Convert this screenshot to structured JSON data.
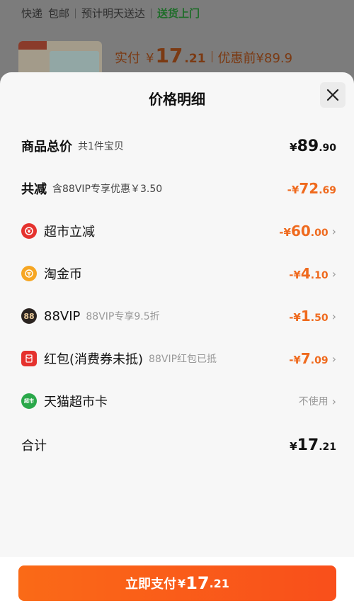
{
  "background": {
    "shipping": [
      "快递",
      "包邮",
      "预计明天送达",
      "送货上门"
    ],
    "price_prefix": "实付",
    "price_symbol": "¥",
    "price_int": "17",
    "price_dec": ".21",
    "before_discount": "优惠前¥89.9"
  },
  "sheet": {
    "title": "价格明细",
    "close_icon": "close-icon"
  },
  "rows": {
    "total": {
      "label": "商品总价",
      "note": "共1件宝贝",
      "sym": "¥",
      "int": "89",
      "dec": ".90"
    },
    "reduce": {
      "label": "共减",
      "note": "含88VIP专享优惠￥3.50",
      "sym": "-¥",
      "int": "72",
      "dec": ".69"
    },
    "supermarket": {
      "label": "超市立减",
      "sym": "-¥",
      "int": "60",
      "dec": ".00",
      "icon": "discount-tag-icon"
    },
    "taojinbi": {
      "label": "淘金币",
      "sym": "-¥",
      "int": "4",
      "dec": ".10",
      "icon": "coin-icon"
    },
    "vip": {
      "label": "88VIP",
      "note": "88VIP专享9.5折",
      "sym": "-¥",
      "int": "1",
      "dec": ".50",
      "icon": "vip-88-icon",
      "icon_text": "88"
    },
    "hongbao": {
      "label": "红包(消费券未抵)",
      "note": "88VIP红包已抵",
      "sym": "-¥",
      "int": "7",
      "dec": ".09",
      "icon": "red-packet-icon"
    },
    "card": {
      "label": "天猫超市卡",
      "status": "不使用",
      "icon": "tmall-card-icon",
      "icon_text": "超市"
    },
    "sum": {
      "label": "合计",
      "sym": "¥",
      "int": "17",
      "dec": ".21"
    }
  },
  "pay": {
    "label": "立即支付",
    "sym": "¥",
    "int": "17",
    "dec": ".21"
  },
  "colors": {
    "accent": "#ef6a1e",
    "pay_button": "#f95a19",
    "green": "#2aa84a"
  }
}
